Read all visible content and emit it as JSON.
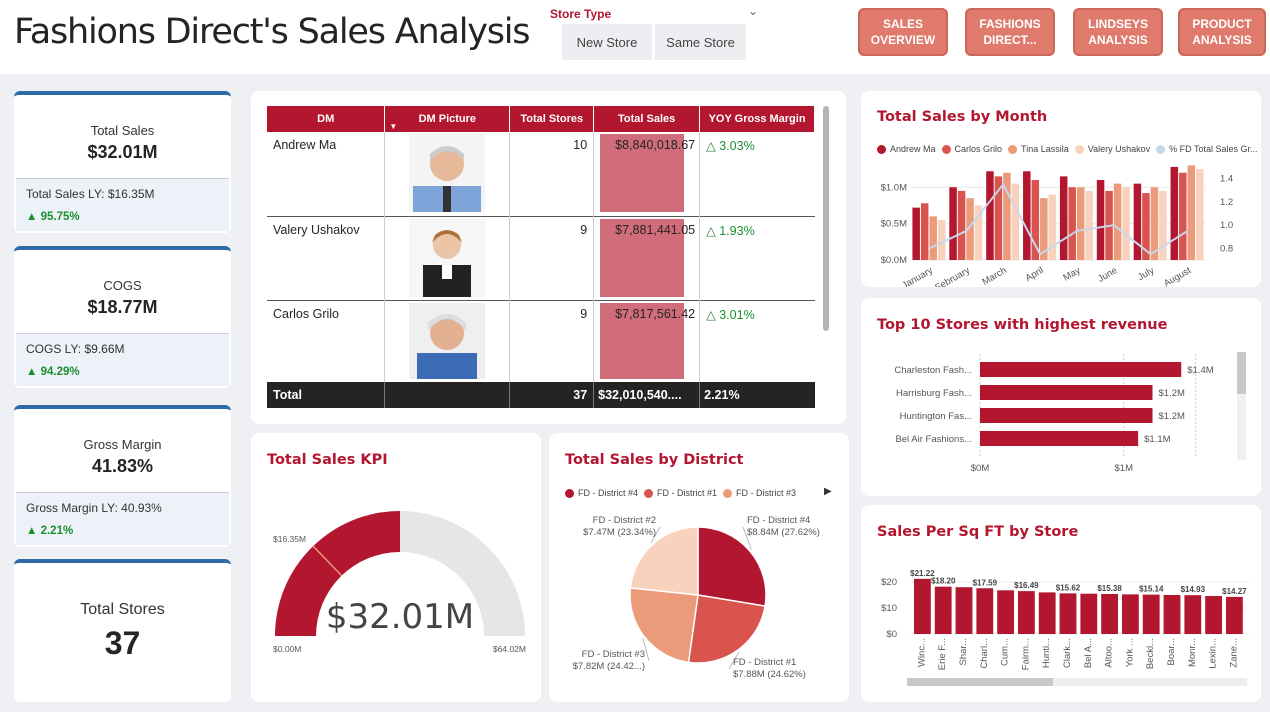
{
  "header": {
    "title": "Fashions Direct's Sales Analysis",
    "store_type_label": "Store Type",
    "store_types": [
      "New Store",
      "Same Store"
    ],
    "nav": [
      "SALES OVERVIEW",
      "FASHIONS DIRECT...",
      "LINDSEYS ANALYSIS",
      "PRODUCT ANALYSIS"
    ]
  },
  "kpis": {
    "total_sales": {
      "label": "Total Sales",
      "value": "$32.01M",
      "ly": "Total Sales LY: $16.35M",
      "pct": "95.75%"
    },
    "cogs": {
      "label": "COGS",
      "value": "$18.77M",
      "ly": "COGS LY: $9.66M",
      "pct": "94.29%"
    },
    "gross_margin": {
      "label": "Gross Margin",
      "value": "41.83%",
      "ly": "Gross Margin LY: 40.93%",
      "pct": "2.21%"
    },
    "total_stores": {
      "label": "Total Stores",
      "value": "37"
    }
  },
  "dm_table": {
    "headers": [
      "DM",
      "DM Picture",
      "Total Stores",
      "Total Sales",
      "YOY Gross Margin"
    ],
    "rows": [
      {
        "dm": "Andrew Ma",
        "stores": "10",
        "sales": "$8,840,018.67",
        "margin": "3.03%"
      },
      {
        "dm": "Valery Ushakov",
        "stores": "9",
        "sales": "$7,881,441.05",
        "margin": "1.93%"
      },
      {
        "dm": "Carlos Grilo",
        "stores": "9",
        "sales": "$7,817,561.42",
        "margin": "3.01%"
      }
    ],
    "total": {
      "label": "Total",
      "stores": "37",
      "sales": "$32,010,540....",
      "margin": "2.21%"
    }
  },
  "colors": {
    "accent": "#b3162f",
    "red2": "#d9534f",
    "orange": "#eb9a7a",
    "peach": "#f8d2bd",
    "kpi_border": "#2d6aa6",
    "nav": "#e07a6d",
    "gauge_bg": "#e6e6e6"
  },
  "sales_by_month": {
    "title": "Total Sales by Month",
    "legend": [
      "Andrew Ma",
      "Carlos Grilo",
      "Tina Lassila",
      "Valery Ushakov",
      "% FD Total Sales Gr..."
    ],
    "yticks": [
      "$1.0M",
      "$0.5M",
      "$0.0M"
    ],
    "y2ticks": [
      "1.4",
      "1.2",
      "1.0",
      "0.8"
    ],
    "months": [
      "January",
      "February",
      "March",
      "April",
      "May",
      "June",
      "July",
      "August"
    ]
  },
  "top_stores": {
    "title": "Top 10 Stores with highest revenue",
    "stores": [
      "Charleston Fash...",
      "Harrisburg Fash...",
      "Huntington Fas...",
      "Bel Air Fashions..."
    ],
    "labels": [
      "$1.4M",
      "$1.2M",
      "$1.2M",
      "$1.1M"
    ],
    "xticks": [
      "$0M",
      "$1M"
    ]
  },
  "kpi_gauge": {
    "title": "Total Sales KPI",
    "value": "$32.01M",
    "target": "$16.35M",
    "min": "$0.00M",
    "max": "$64.02M"
  },
  "district": {
    "title": "Total Sales by District",
    "legend": [
      "FD - District #4",
      "FD - District #1",
      "FD - District #3"
    ],
    "slices": [
      {
        "name": "FD - District #4",
        "label": "$8.84M (27.62%)"
      },
      {
        "name": "FD - District #1",
        "label": "$7.88M (24.62%)"
      },
      {
        "name": "FD - District #3",
        "label": "$7.82M (24.42...)"
      },
      {
        "name": "FD - District #2",
        "label": "$7.47M (23.34%)"
      }
    ]
  },
  "sqft": {
    "title": "Sales Per Sq FT by Store",
    "yticks": [
      "$20",
      "$10",
      "$0"
    ],
    "labels": [
      "$21.22",
      "$18.20",
      "$17.59",
      "$16.49",
      "$15.62",
      "$15.38",
      "$15.14",
      "$14.93",
      "$14.27"
    ],
    "stores": [
      "Winc...",
      "Erie F...",
      "Shar...",
      "Charl...",
      "Cum...",
      "Fairm...",
      "Hunti...",
      "Clark...",
      "Bel A...",
      "Altoo...",
      "York ...",
      "Beckl...",
      "Boar...",
      "Monr...",
      "Lexin...",
      "Zane..."
    ]
  },
  "chart_data": [
    {
      "type": "bar",
      "title": "Total Sales by Month",
      "categories": [
        "January",
        "February",
        "March",
        "April",
        "May",
        "June",
        "July",
        "August"
      ],
      "series": [
        {
          "name": "Andrew Ma",
          "values": [
            0.72,
            1.0,
            1.22,
            1.22,
            1.15,
            1.1,
            1.05,
            1.28
          ]
        },
        {
          "name": "Carlos Grilo",
          "values": [
            0.78,
            0.95,
            1.15,
            1.1,
            1.0,
            0.95,
            0.92,
            1.2
          ]
        },
        {
          "name": "Tina Lassila",
          "values": [
            0.6,
            0.85,
            1.2,
            0.85,
            1.0,
            1.05,
            1.0,
            1.3
          ]
        },
        {
          "name": "Valery Ushakov",
          "values": [
            0.55,
            0.75,
            1.05,
            0.9,
            0.95,
            1.0,
            0.95,
            1.25
          ]
        }
      ],
      "line": {
        "name": "% FD Total Sales Gr...",
        "values": [
          0.8,
          0.95,
          1.35,
          0.75,
          0.95,
          1.0,
          0.75,
          0.95
        ]
      },
      "ylim": [
        0,
        1.1
      ]
    },
    {
      "type": "bar",
      "title": "Top 10 Stores with highest revenue",
      "categories": [
        "Charleston Fash...",
        "Harrisburg Fash...",
        "Huntington Fas...",
        "Bel Air Fashions..."
      ],
      "values": [
        1.4,
        1.2,
        1.2,
        1.1
      ]
    },
    {
      "type": "pie",
      "title": "Total Sales by District",
      "categories": [
        "FD - District #4",
        "FD - District #1",
        "FD - District #3",
        "FD - District #2"
      ],
      "values": [
        8.84,
        7.88,
        7.82,
        7.47
      ]
    },
    {
      "type": "bar",
      "title": "Sales Per Sq FT by Store",
      "categories": [
        "Winc...",
        "Erie F...",
        "Shar...",
        "Charl...",
        "Cum...",
        "Fairm...",
        "Hunti...",
        "Clark...",
        "Bel A...",
        "Altoo...",
        "York ...",
        "Beckl...",
        "Boar...",
        "Monr...",
        "Lexin...",
        "Zane..."
      ],
      "values": [
        21.22,
        18.2,
        18.0,
        17.59,
        16.8,
        16.49,
        16.0,
        15.62,
        15.5,
        15.38,
        15.25,
        15.14,
        15.0,
        14.93,
        14.6,
        14.27
      ],
      "ylim": [
        0,
        25
      ]
    },
    {
      "type": "gauge",
      "title": "Total Sales KPI",
      "value": 32.01,
      "target": 16.35,
      "min": 0,
      "max": 64.02
    }
  ]
}
